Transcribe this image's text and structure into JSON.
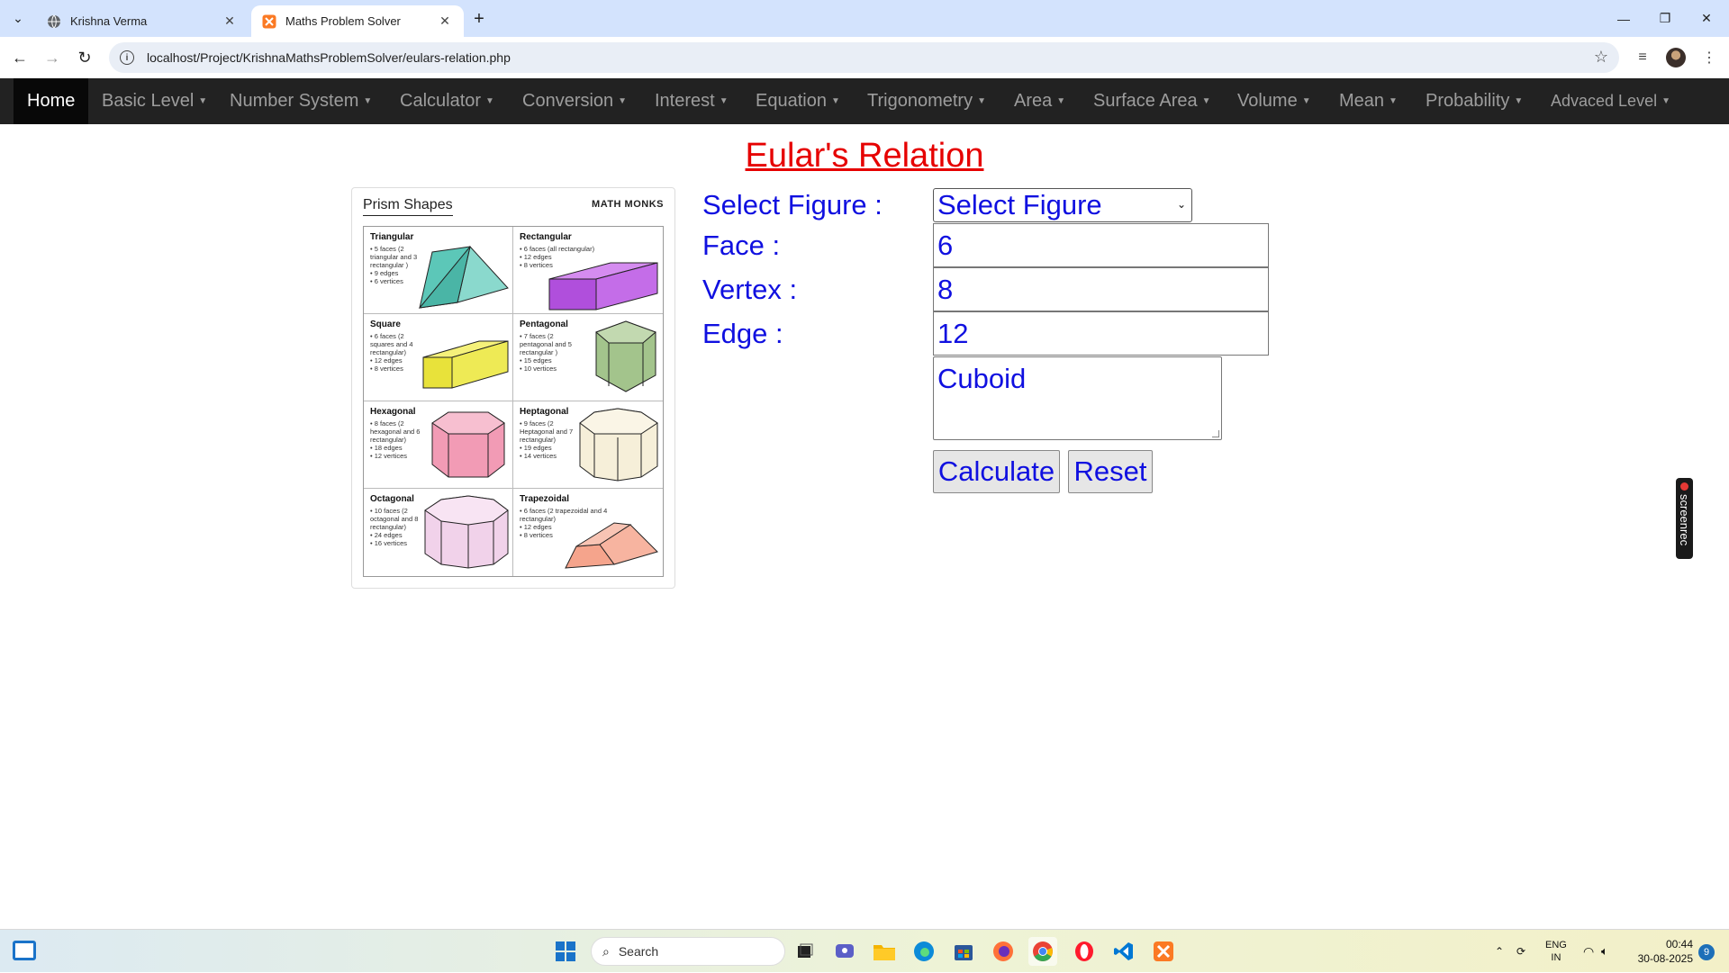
{
  "browser": {
    "tabs": [
      {
        "title": "Krishna Verma",
        "active": false
      },
      {
        "title": "Maths Problem Solver",
        "active": true
      }
    ],
    "url": "localhost/Project/KrishnaMathsProblemSolver/eulars-relation.php"
  },
  "nav": {
    "home": "Home",
    "items": [
      "Basic Level",
      "Number System",
      "Calculator",
      "Conversion",
      "Interest",
      "Equation",
      "Trigonometry",
      "Area",
      "Surface Area",
      "Volume",
      "Mean",
      "Probability",
      "Advaced Level"
    ]
  },
  "page": {
    "title": "Eular's Relation",
    "image": {
      "heading": "Prism Shapes",
      "logo": "MATH MONKS",
      "cells": [
        {
          "title": "Triangular",
          "lines": [
            "5 faces (2 triangular and 3 rectangular )",
            "9 edges",
            "6 vertices"
          ]
        },
        {
          "title": "Rectangular",
          "lines": [
            "6 faces (all rectangular)",
            "12 edges",
            "8 vertices"
          ]
        },
        {
          "title": "Square",
          "lines": [
            "6 faces (2 squares and 4 rectangular)",
            "12 edges",
            "8 vertices"
          ]
        },
        {
          "title": "Pentagonal",
          "lines": [
            "7 faces (2 pentagonal and 5 rectangular )",
            "15 edges",
            "10 vertices"
          ]
        },
        {
          "title": "Hexagonal",
          "lines": [
            "8 faces (2 hexagonal and 6 rectangular)",
            "18 edges",
            "12 vertices"
          ]
        },
        {
          "title": "Heptagonal",
          "lines": [
            "9 faces (2 Heptagonal and 7 rectangular)",
            "19 edges",
            "14 vertices"
          ]
        },
        {
          "title": "Octagonal",
          "lines": [
            "10 faces (2 octagonal and 8 rectangular)",
            "24 edges",
            "16 vertices"
          ]
        },
        {
          "title": "Trapezoidal",
          "lines": [
            "6 faces (2 trapezoidal and 4 rectangular)",
            "12 edges",
            "8 vertices"
          ]
        }
      ]
    },
    "form": {
      "select_label": "Select Figure :",
      "select_value": "Select Figure",
      "face_label": "Face :",
      "face_value": "6",
      "vertex_label": "Vertex :",
      "vertex_value": "8",
      "edge_label": "Edge :",
      "edge_value": "12",
      "result_value": "Cuboid",
      "calculate_label": "Calculate",
      "reset_label": "Reset"
    },
    "screenrec_label": "screenrec"
  },
  "taskbar": {
    "search_placeholder": "Search",
    "lang_top": "ENG",
    "lang_bottom": "IN",
    "time": "00:44",
    "date": "30-08-2025",
    "notification_count": "9"
  },
  "colors": {
    "accent_title": "#e60000",
    "form_text": "#1010e0",
    "navbar_bg": "#222222"
  }
}
